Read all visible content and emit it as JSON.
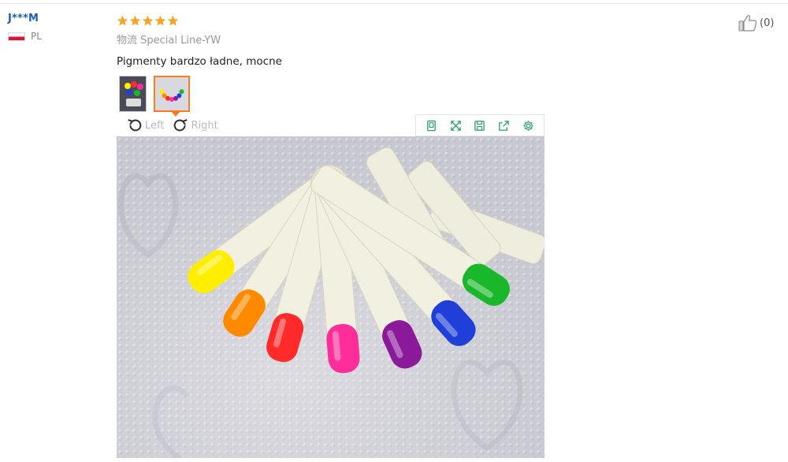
{
  "reviewer": {
    "name": "J***M",
    "country_code": "PL",
    "flag_colors": [
      "#ffffff",
      "#dc143c"
    ]
  },
  "review": {
    "rating": 5,
    "max_rating": 5,
    "star_color": "#f5a623",
    "logistics": "物流 Special Line-YW",
    "text": "Pigmenty bardzo ładne, mocne"
  },
  "viewer": {
    "rotate_left": "Left",
    "rotate_right": "Right",
    "toolbar_icons": [
      "fit-screen-icon",
      "fullscreen-icon",
      "save-icon",
      "share-icon",
      "settings-icon"
    ],
    "accent_color": "#2aa36b",
    "photo_swatches": [
      "#ffee00",
      "#ff8a00",
      "#ff2a2a",
      "#ff2d9a",
      "#8a1a9a",
      "#1f3fd8",
      "#19b82a"
    ]
  },
  "helpful": {
    "count_label": "(0)"
  },
  "thumbnails": [
    {
      "name": "thumbnail-1",
      "active": false
    },
    {
      "name": "thumbnail-2",
      "active": true
    }
  ]
}
